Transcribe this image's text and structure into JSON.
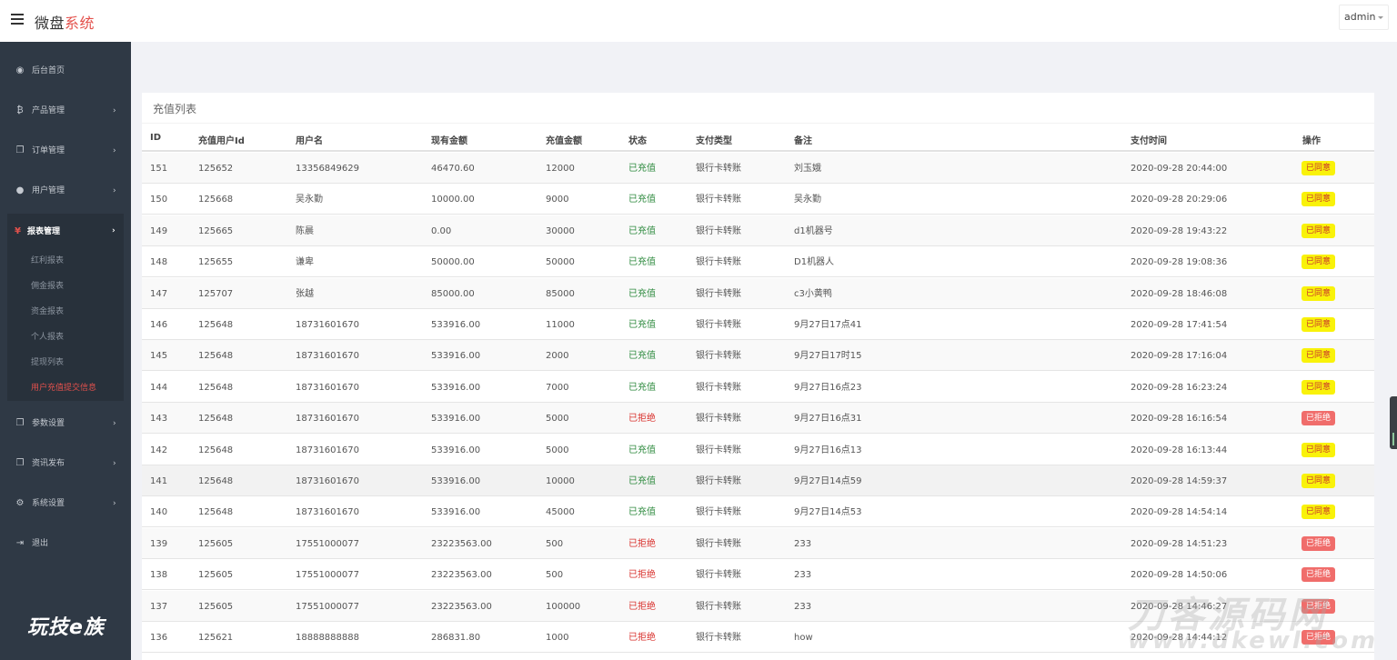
{
  "header": {
    "brand_main": "微盘",
    "brand_accent": "系统",
    "user_label": "admin"
  },
  "sidebar": {
    "items": [
      {
        "label": "后台首页",
        "icon": "dashboard-icon",
        "has_arrow": false
      },
      {
        "label": "产品管理",
        "icon": "bitcoin-icon",
        "has_arrow": true
      },
      {
        "label": "订单管理",
        "icon": "copy-icon",
        "has_arrow": true
      },
      {
        "label": "用户管理",
        "icon": "user-icon",
        "has_arrow": true
      }
    ],
    "open_group": {
      "label": "报表管理",
      "icon": "yen-icon",
      "children": [
        "红利报表",
        "佣金报表",
        "资金报表",
        "个人报表",
        "提现列表",
        "用户充值提交信息"
      ],
      "active_child": "用户充值提交信息"
    },
    "items_after": [
      {
        "label": "参数设置",
        "icon": "copy-icon",
        "has_arrow": true
      },
      {
        "label": "资讯发布",
        "icon": "copy-icon",
        "has_arrow": true
      },
      {
        "label": "系统设置",
        "icon": "gears-icon",
        "has_arrow": true
      },
      {
        "label": "退出",
        "icon": "sign-out-icon",
        "has_arrow": false
      }
    ],
    "watermark": "玩技e族"
  },
  "panel": {
    "title": "充值列表",
    "columns": [
      "ID",
      "充值用户Id",
      "用户名",
      "现有金额",
      "充值金额",
      "状态",
      "支付类型",
      "备注",
      "支付时间",
      "操作"
    ],
    "rows": [
      {
        "id": "151",
        "uid": "125652",
        "name": "13356849629",
        "balance": "46470.60",
        "amount": "12000",
        "status": "已充值",
        "status_ok": true,
        "pay": "银行卡转账",
        "note": "刘玉娥",
        "time": "2020-09-28 20:44:00",
        "action": "已同意"
      },
      {
        "id": "150",
        "uid": "125668",
        "name": "吴永勤",
        "balance": "10000.00",
        "amount": "9000",
        "status": "已充值",
        "status_ok": true,
        "pay": "银行卡转账",
        "note": "吴永勤",
        "time": "2020-09-28 20:29:06",
        "action": "已同意"
      },
      {
        "id": "149",
        "uid": "125665",
        "name": "陈晨",
        "balance": "0.00",
        "amount": "30000",
        "status": "已充值",
        "status_ok": true,
        "pay": "银行卡转账",
        "note": "d1机器号",
        "time": "2020-09-28 19:43:22",
        "action": "已同意"
      },
      {
        "id": "148",
        "uid": "125655",
        "name": "谦卑",
        "balance": "50000.00",
        "amount": "50000",
        "status": "已充值",
        "status_ok": true,
        "pay": "银行卡转账",
        "note": "D1机器人",
        "time": "2020-09-28 19:08:36",
        "action": "已同意"
      },
      {
        "id": "147",
        "uid": "125707",
        "name": "张越",
        "balance": "85000.00",
        "amount": "85000",
        "status": "已充值",
        "status_ok": true,
        "pay": "银行卡转账",
        "note": "c3小黄鸭",
        "time": "2020-09-28 18:46:08",
        "action": "已同意"
      },
      {
        "id": "146",
        "uid": "125648",
        "name": "18731601670",
        "balance": "533916.00",
        "amount": "11000",
        "status": "已充值",
        "status_ok": true,
        "pay": "银行卡转账",
        "note": "9月27日17点41",
        "time": "2020-09-28 17:41:54",
        "action": "已同意"
      },
      {
        "id": "145",
        "uid": "125648",
        "name": "18731601670",
        "balance": "533916.00",
        "amount": "2000",
        "status": "已充值",
        "status_ok": true,
        "pay": "银行卡转账",
        "note": "9月27日17时15",
        "time": "2020-09-28 17:16:04",
        "action": "已同意"
      },
      {
        "id": "144",
        "uid": "125648",
        "name": "18731601670",
        "balance": "533916.00",
        "amount": "7000",
        "status": "已充值",
        "status_ok": true,
        "pay": "银行卡转账",
        "note": "9月27日16点23",
        "time": "2020-09-28 16:23:24",
        "action": "已同意"
      },
      {
        "id": "143",
        "uid": "125648",
        "name": "18731601670",
        "balance": "533916.00",
        "amount": "5000",
        "status": "已拒绝",
        "status_ok": false,
        "pay": "银行卡转账",
        "note": "9月27日16点31",
        "time": "2020-09-28 16:16:54",
        "action": "已拒绝"
      },
      {
        "id": "142",
        "uid": "125648",
        "name": "18731601670",
        "balance": "533916.00",
        "amount": "5000",
        "status": "已充值",
        "status_ok": true,
        "pay": "银行卡转账",
        "note": "9月27日16点13",
        "time": "2020-09-28 16:13:44",
        "action": "已同意"
      },
      {
        "id": "141",
        "uid": "125648",
        "name": "18731601670",
        "balance": "533916.00",
        "amount": "10000",
        "status": "已充值",
        "status_ok": true,
        "pay": "银行卡转账",
        "note": "9月27日14点59",
        "time": "2020-09-28 14:59:37",
        "action": "已同意"
      },
      {
        "id": "140",
        "uid": "125648",
        "name": "18731601670",
        "balance": "533916.00",
        "amount": "45000",
        "status": "已充值",
        "status_ok": true,
        "pay": "银行卡转账",
        "note": "9月27日14点53",
        "time": "2020-09-28 14:54:14",
        "action": "已同意"
      },
      {
        "id": "139",
        "uid": "125605",
        "name": "17551000077",
        "balance": "23223563.00",
        "amount": "500",
        "status": "已拒绝",
        "status_ok": false,
        "pay": "银行卡转账",
        "note": "233",
        "time": "2020-09-28 14:51:23",
        "action": "已拒绝"
      },
      {
        "id": "138",
        "uid": "125605",
        "name": "17551000077",
        "balance": "23223563.00",
        "amount": "500",
        "status": "已拒绝",
        "status_ok": false,
        "pay": "银行卡转账",
        "note": "233",
        "time": "2020-09-28 14:50:06",
        "action": "已拒绝"
      },
      {
        "id": "137",
        "uid": "125605",
        "name": "17551000077",
        "balance": "23223563.00",
        "amount": "100000",
        "status": "已拒绝",
        "status_ok": false,
        "pay": "银行卡转账",
        "note": "233",
        "time": "2020-09-28 14:46:27",
        "action": "已拒绝"
      },
      {
        "id": "136",
        "uid": "125621",
        "name": "18888888888",
        "balance": "286831.80",
        "amount": "1000",
        "status": "已拒绝",
        "status_ok": false,
        "pay": "银行卡转账",
        "note": "how",
        "time": "2020-09-28 14:44:12",
        "action": "已拒绝"
      }
    ]
  },
  "watermark_right": "刀客源码网",
  "watermark_right_sub": "www.dkewl.com",
  "colors": {
    "sidebar_bg": "#2f3945",
    "accent_red": "#e3514c",
    "status_ok": "#2d8a3e",
    "status_rejected": "#d9322e",
    "badge_agree_bg": "#f9f20a",
    "badge_reject_bg": "#f06d6b"
  }
}
